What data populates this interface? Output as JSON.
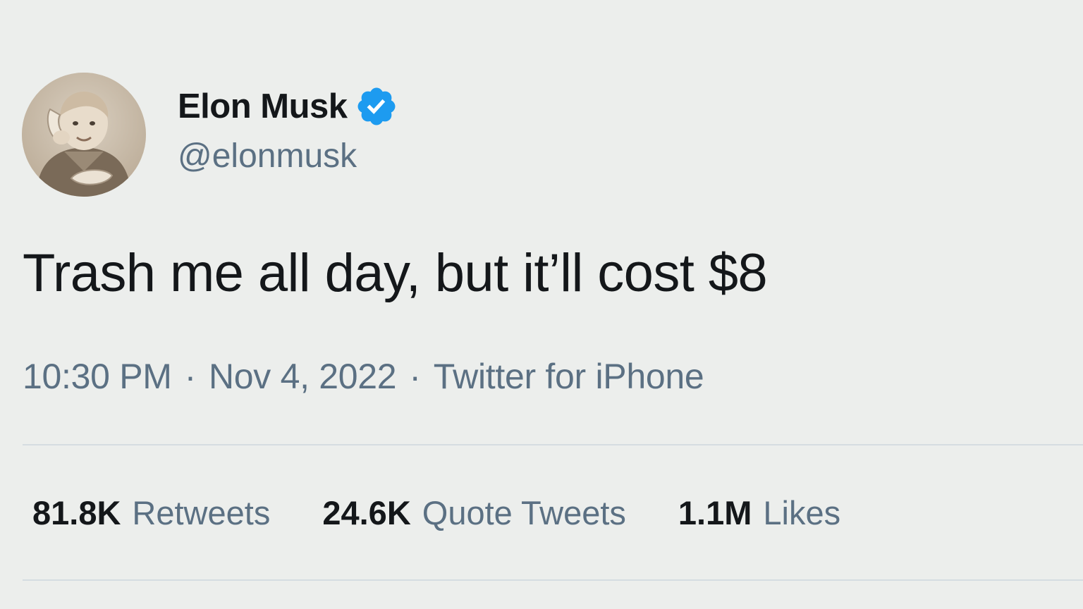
{
  "user": {
    "display_name": "Elon Musk",
    "handle": "@elonmusk",
    "verified_icon": "verified-badge-icon",
    "avatar": "childhood-photo-avatar"
  },
  "tweet": {
    "text": "Trash me all day, but it’ll cost $8",
    "time": "10:30 PM",
    "separator": "·",
    "date": "Nov 4, 2022",
    "source": "Twitter for iPhone"
  },
  "stats": {
    "retweets_value": "81.8K",
    "retweets_label": "Retweets",
    "quotes_value": "24.6K",
    "quotes_label": "Quote Tweets",
    "likes_value": "1.1M",
    "likes_label": "Likes"
  },
  "colors": {
    "background": "#eceeec",
    "text_primary": "#14171a",
    "text_secondary": "#5b7083",
    "verified_blue": "#1d9bf0",
    "divider": "#d5dce1"
  }
}
